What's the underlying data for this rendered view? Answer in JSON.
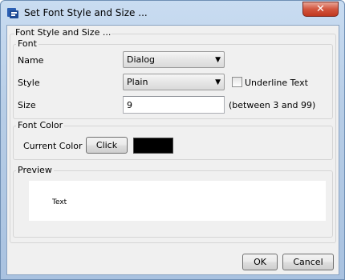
{
  "window": {
    "title": "Set Font Style and Size ...",
    "close_symbol": "✕",
    "app_icon": "java-app-icon"
  },
  "panel": {
    "title": "Font Style and Size ..."
  },
  "font_group": {
    "title": "Font",
    "name_label": "Name",
    "name_value": "Dialog",
    "style_label": "Style",
    "style_value": "Plain",
    "underline_label": "Underline Text",
    "underline_checked": false,
    "size_label": "Size",
    "size_value": "9",
    "size_hint": "(between 3 and 99)"
  },
  "color_group": {
    "title": "Font Color",
    "current_label": "Current Color :",
    "click_label": "Click",
    "current_color": "#000000"
  },
  "preview_group": {
    "title": "Preview",
    "sample_text": "Text"
  },
  "buttons": {
    "ok": "OK",
    "cancel": "Cancel"
  },
  "icons": {
    "combo_arrow": "▼"
  }
}
